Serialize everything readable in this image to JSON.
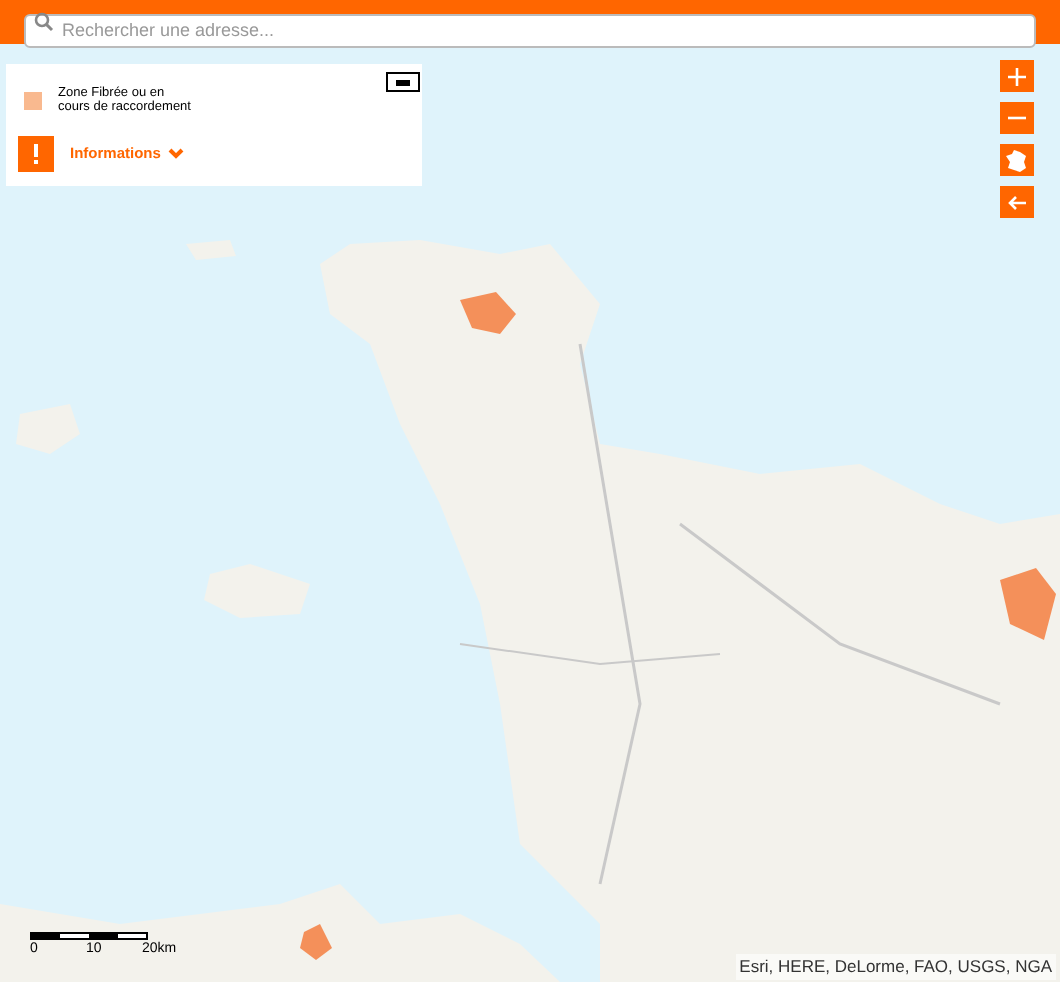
{
  "search": {
    "placeholder": "Rechercher une adresse..."
  },
  "legend": {
    "items": [
      {
        "label": "Zone Fibrée ou en cours de raccordement",
        "color": "#f9b98f"
      }
    ],
    "info_label": "Informations",
    "expanded": false
  },
  "scale": {
    "labels": [
      "0",
      "10",
      "20km"
    ]
  },
  "attribution": "Esri, HERE, DeLorme, FAO, USGS, NGA"
}
